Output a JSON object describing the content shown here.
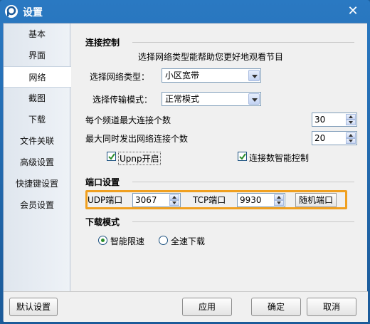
{
  "window": {
    "title": "设置",
    "close_glyph": "✕",
    "accent": "#2a79c2"
  },
  "sidebar": {
    "active": "网络",
    "items": [
      {
        "label": "基本"
      },
      {
        "label": "界面"
      },
      {
        "label": "网络"
      },
      {
        "label": "截图"
      },
      {
        "label": "下载"
      },
      {
        "label": "文件关联"
      },
      {
        "label": "高级设置"
      },
      {
        "label": "快捷键设置"
      },
      {
        "label": "会员设置"
      }
    ]
  },
  "connection": {
    "title": "连接控制",
    "hint": "选择网络类型能帮助您更好地观看节目",
    "network_type_label": "选择网络类型：",
    "network_type_value": "小区宽带",
    "transfer_mode_label": "选择传输模式：",
    "transfer_mode_value": "正常模式",
    "max_per_channel_label": "每个频道最大连接个数",
    "max_per_channel_value": "30",
    "max_concurrent_label": "最大同时发出网络连接个数",
    "max_concurrent_value": "20",
    "upnp_label": "Upnp开启",
    "upnp_checked": true,
    "smart_conn_label": "连接数智能控制",
    "smart_conn_checked": true
  },
  "ports": {
    "title": "端口设置",
    "udp_label": "UDP端口",
    "udp_value": "3067",
    "tcp_label": "TCP端口",
    "tcp_value": "9930",
    "random_label": "随机端口",
    "highlight_color": "#f0a020"
  },
  "download": {
    "title": "下载模式",
    "smart_limit_label": "智能限速",
    "full_speed_label": "全速下载",
    "selected": "智能限速"
  },
  "footer": {
    "default_label": "默认设置",
    "apply_label": "应用",
    "ok_label": "确定",
    "cancel_label": "取消"
  }
}
